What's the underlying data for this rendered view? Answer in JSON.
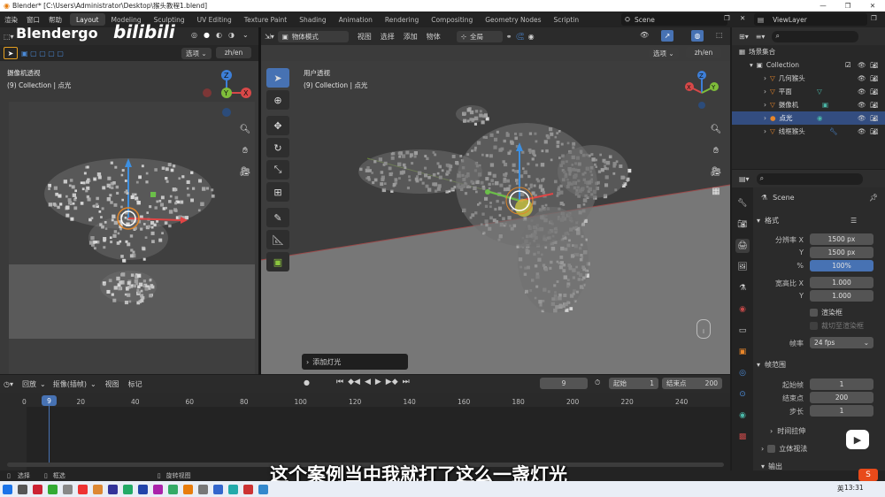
{
  "window": {
    "title": "Blender* [C:\\Users\\Administrator\\Desktop\\猴头教程1.blend]"
  },
  "menu": [
    "渲染",
    "窗口",
    "帮助"
  ],
  "workspaces": [
    "Layout",
    "Modeling",
    "Sculpting",
    "UV Editing",
    "Texture Paint",
    "Shading",
    "Animation",
    "Rendering",
    "Compositing",
    "Geometry Nodes",
    "Scriptin"
  ],
  "scene_name": "Scene",
  "view_layer": "ViewLayer",
  "watermark": {
    "channel": "Blendergo",
    "site": "bilibili"
  },
  "left_viewport": {
    "options": "选项",
    "lang": "zh/en",
    "view_name": "摄像机透视",
    "collection_info": "(9) Collection | 点光"
  },
  "main_viewport": {
    "mode": "物体模式",
    "menus": [
      "视图",
      "选择",
      "添加",
      "物体"
    ],
    "transform": "全局",
    "options": "选项",
    "lang": "zh/en",
    "view_name": "用户透视",
    "collection_info": "(9) Collection | 点光",
    "last_op": "添加灯光"
  },
  "outliner": {
    "header": "场景集合",
    "collection": "Collection",
    "items": [
      {
        "name": "几何猴头",
        "selected": false
      },
      {
        "name": "平面",
        "selected": false
      },
      {
        "name": "摄像机",
        "selected": false
      },
      {
        "name": "点光",
        "selected": true
      },
      {
        "name": "线框猴头",
        "selected": false
      }
    ]
  },
  "properties": {
    "scene": "Scene",
    "format_panel": "格式",
    "resolution_x_label": "分辨率 X",
    "resolution_x": "1500 px",
    "resolution_y_label": "Y",
    "resolution_y": "1500 px",
    "percent_label": "%",
    "percent": "100%",
    "aspect_x_label": "宽高比 X",
    "aspect_x": "1.000",
    "aspect_y_label": "Y",
    "aspect_y": "1.000",
    "render_region": "渲染框",
    "crop_region": "裁切至渲染框",
    "fps_label": "帧率",
    "fps": "24 fps",
    "frame_range_panel": "帧范围",
    "frame_start_label": "起始帧",
    "frame_start": "1",
    "frame_end_label": "结束点",
    "frame_end": "200",
    "frame_step_label": "步长",
    "frame_step": "1",
    "time_stretch": "时间拉伸",
    "stereoscopy": "立体视法",
    "output": "输出"
  },
  "timeline": {
    "menus": [
      "回放",
      "抠像(插帧)",
      "视图",
      "标记"
    ],
    "current_frame": "9",
    "start_label": "起始",
    "start": "1",
    "end_label": "结束点",
    "end": "200",
    "ticks": [
      "0",
      "9",
      "20",
      "40",
      "60",
      "80",
      "100",
      "120",
      "140",
      "160",
      "180",
      "200",
      "220",
      "240"
    ]
  },
  "statusbar": {
    "select": "选择",
    "box_select": "框选",
    "rotate_view": "旋转视图"
  },
  "subtitle": "这个案例当中我就打了这么一盏灯光",
  "taskbar": {
    "time": "13:31",
    "ime": "英"
  }
}
